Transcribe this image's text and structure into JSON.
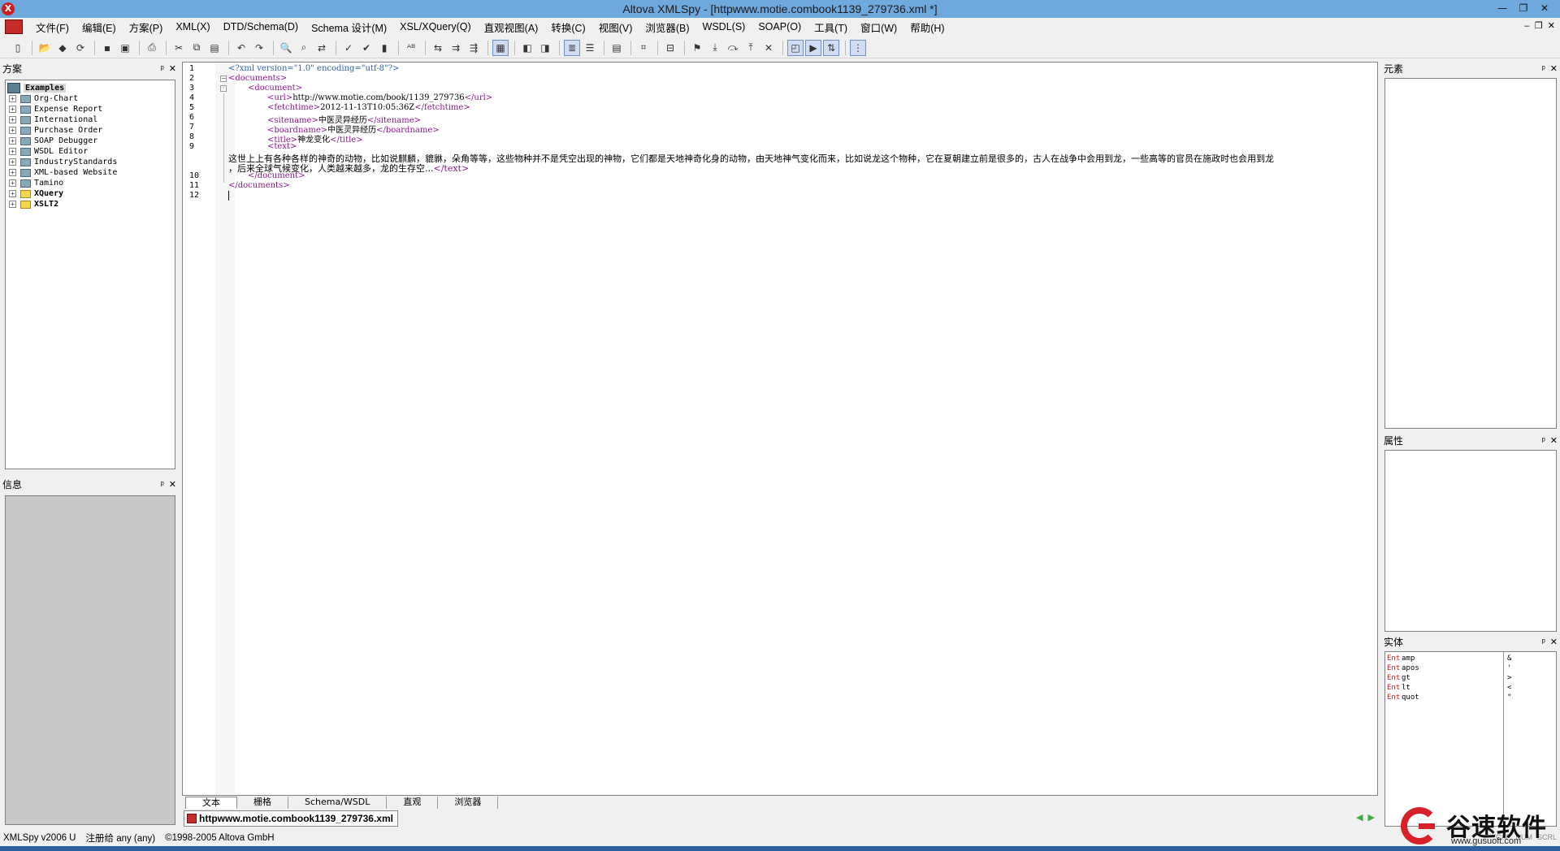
{
  "titlebar": {
    "title": "Altova XMLSpy - [httpwww.motie.combook1139_279736.xml *]"
  },
  "menu": [
    "文件(F)",
    "编辑(E)",
    "方案(P)",
    "XML(X)",
    "DTD/Schema(D)",
    "Schema 设计(M)",
    "XSL/XQuery(Q)",
    "直观视图(A)",
    "转换(C)",
    "视图(V)",
    "浏览器(B)",
    "WSDL(S)",
    "SOAP(O)",
    "工具(T)",
    "窗口(W)",
    "帮助(H)"
  ],
  "project_panel": {
    "title": "方案",
    "root": "Examples",
    "items": [
      {
        "label": "Org-Chart",
        "folder": "blue",
        "bold": false
      },
      {
        "label": "Expense Report",
        "folder": "blue",
        "bold": false
      },
      {
        "label": "International",
        "folder": "blue",
        "bold": false
      },
      {
        "label": "Purchase Order",
        "folder": "blue",
        "bold": false
      },
      {
        "label": "SOAP Debugger",
        "folder": "blue",
        "bold": false
      },
      {
        "label": "WSDL Editor",
        "folder": "blue",
        "bold": false
      },
      {
        "label": "IndustryStandards",
        "folder": "blue",
        "bold": false
      },
      {
        "label": "XML-based Website",
        "folder": "blue",
        "bold": false
      },
      {
        "label": "Tamino",
        "folder": "blue",
        "bold": false
      },
      {
        "label": "XQuery",
        "folder": "yellow",
        "bold": true
      },
      {
        "label": "XSLT2",
        "folder": "yellow",
        "bold": true
      }
    ]
  },
  "info_panel": {
    "title": "信息"
  },
  "elements_panel": {
    "title": "元素"
  },
  "attributes_panel": {
    "title": "属性"
  },
  "entities_panel": {
    "title": "实体",
    "rows": [
      {
        "type": "Ent",
        "name": "amp",
        "value": "&"
      },
      {
        "type": "Ent",
        "name": "apos",
        "value": "'"
      },
      {
        "type": "Ent",
        "name": "gt",
        "value": ">"
      },
      {
        "type": "Ent",
        "name": "lt",
        "value": "<"
      },
      {
        "type": "Ent",
        "name": "quot",
        "value": "\""
      }
    ]
  },
  "editor": {
    "line_numbers": [
      "1",
      "2",
      "3",
      "4",
      "5",
      "6",
      "7",
      "8",
      "9",
      "10",
      "11",
      "12"
    ],
    "lines": {
      "l1": "<?xml version=\"1.0\" encoding=\"utf-8\"?>",
      "l2": "<documents>",
      "l3": "<document>",
      "l4_open": "<url>",
      "l4_text": "http://www.motie.com/book/1139_279736",
      "l4_close": "</url>",
      "l5_open": "<fetchtime>",
      "l5_text": "2012-11-13T10:05:36Z",
      "l5_close": "</fetchtime>",
      "l6_open": "<sitename>",
      "l6_text": "中医灵异经历",
      "l6_close": "</sitename>",
      "l7_open": "<boardname>",
      "l7_text": "中医灵异经历",
      "l7_close": "</boardname>",
      "l8_open": "<title>",
      "l8_text": "神龙变化",
      "l8_close": "</title>",
      "l9_open": "<text>",
      "l9_text_a": "这世上上有各种各样的神奇的动物，比如说麒麟，貔貅，朵角等等，这些物种并不是凭空出现的神物，它们都是天地神奇化身的动物，由天地神气变化而来，比如说龙这个物种，它在夏朝建立前是很多的，古人在战争中会用到龙，一些高等的官员在施政时也会用到龙",
      "l9_text_b": "，后来全球气候变化，人类越来越多，龙的生存空...",
      "l9_close": "</text>",
      "l10": "</document>",
      "l11": "</documents>"
    },
    "view_tabs": [
      "文本",
      "栅格",
      "Schema/WSDL",
      "直观",
      "浏览器"
    ],
    "doc_tab": "httpwww.motie.combook1139_279736.xml"
  },
  "status": {
    "version": "XMLSpy v2006 U",
    "registered": "注册给 any (any)",
    "copyright": "©1998-2005 Altova GmbH",
    "indicators": [
      "CAP",
      "NUM",
      "SCRL"
    ]
  },
  "watermark": {
    "brand": "谷速软件",
    "url": "www.gusuoft.com"
  },
  "colors": {
    "titlebar": "#6fa8dc",
    "tag": "#8a1a8a",
    "pi": "#3060b0",
    "entity_type": "#cc2222",
    "watermark": "#d8202b"
  }
}
